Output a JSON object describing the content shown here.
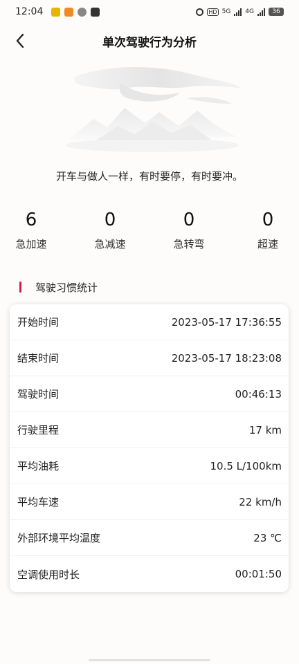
{
  "status_bar": {
    "time": "12:04",
    "network_5g": "5G",
    "network_4g": "4G",
    "hd": "HD",
    "battery": "36"
  },
  "header": {
    "title": "单次驾驶行为分析"
  },
  "motto": "开车与做人一样，有时要停，有时要冲。",
  "stats": [
    {
      "value": "6",
      "label": "急加速"
    },
    {
      "value": "0",
      "label": "急减速"
    },
    {
      "value": "0",
      "label": "急转弯"
    },
    {
      "value": "0",
      "label": "超速"
    }
  ],
  "section": {
    "title": "驾驶习惯统计",
    "accent_color": "#d21c3c"
  },
  "details": [
    {
      "label": "开始时间",
      "value": "2023-05-17 17:36:55"
    },
    {
      "label": "结束时间",
      "value": "2023-05-17 18:23:08"
    },
    {
      "label": "驾驶时间",
      "value": "00:46:13"
    },
    {
      "label": "行驶里程",
      "value": "17 km"
    },
    {
      "label": "平均油耗",
      "value": "10.5 L/100km"
    },
    {
      "label": "平均车速",
      "value": "22 km/h"
    },
    {
      "label": "外部环境平均温度",
      "value": "23 ℃"
    },
    {
      "label": "空调使用时长",
      "value": "00:01:50"
    }
  ]
}
